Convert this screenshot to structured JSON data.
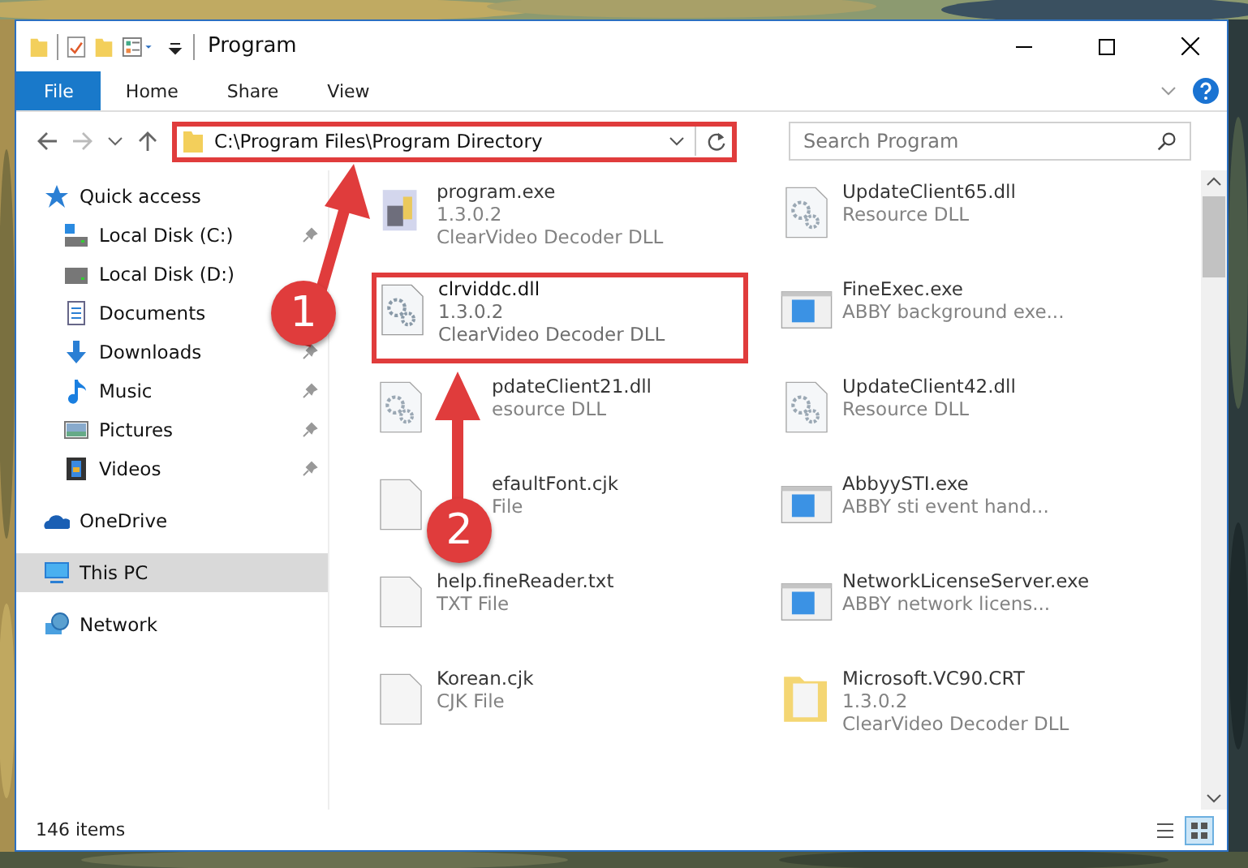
{
  "window": {
    "title": "Program"
  },
  "ribbon_tabs": [
    {
      "label": "File",
      "selected": true
    },
    {
      "label": "Home",
      "selected": false
    },
    {
      "label": "Share",
      "selected": false
    },
    {
      "label": "View",
      "selected": false
    }
  ],
  "address": {
    "path": "C:\\Program Files\\Program Directory",
    "highlighted": true
  },
  "search": {
    "placeholder": "Search Program"
  },
  "sidebar": {
    "items": [
      {
        "label": "Quick access",
        "kind": "star",
        "indent": false,
        "pinned": false,
        "selected": false
      },
      {
        "label": "Local Disk (C:)",
        "kind": "windrive",
        "indent": true,
        "pinned": true,
        "selected": false
      },
      {
        "label": "Local Disk (D:)",
        "kind": "drive",
        "indent": true,
        "pinned": false,
        "selected": false
      },
      {
        "label": "Documents",
        "kind": "documents",
        "indent": true,
        "pinned": false,
        "selected": false
      },
      {
        "label": "Downloads",
        "kind": "downloads",
        "indent": true,
        "pinned": true,
        "selected": false
      },
      {
        "label": "Music",
        "kind": "music",
        "indent": true,
        "pinned": true,
        "selected": false
      },
      {
        "label": "Pictures",
        "kind": "pictures",
        "indent": true,
        "pinned": true,
        "selected": false
      },
      {
        "label": "Videos",
        "kind": "videos",
        "indent": true,
        "pinned": true,
        "selected": false
      },
      {
        "label": "OneDrive",
        "kind": "cloud",
        "indent": false,
        "pinned": false,
        "selected": false
      },
      {
        "label": "This PC",
        "kind": "pc",
        "indent": false,
        "pinned": false,
        "selected": true
      },
      {
        "label": "Network",
        "kind": "network",
        "indent": false,
        "pinned": false,
        "selected": false
      }
    ]
  },
  "files": [
    {
      "name": "program.exe",
      "lines": [
        "1.3.0.2",
        "ClearVideo Decoder DLL"
      ],
      "kind": "app",
      "blurred": true,
      "highlighted": false,
      "covered": false
    },
    {
      "name": "UpdateClient65.dll",
      "lines": [
        "Resource DLL"
      ],
      "kind": "dll",
      "blurred": true,
      "highlighted": false,
      "covered": false
    },
    {
      "name": "clrviddc.dll",
      "lines": [
        "1.3.0.2",
        "ClearVideo Decoder DLL"
      ],
      "kind": "dll",
      "blurred": false,
      "highlighted": true,
      "covered": false
    },
    {
      "name": "FineExec.exe",
      "lines": [
        "ABBY background exe..."
      ],
      "kind": "exe",
      "blurred": true,
      "highlighted": false,
      "covered": false
    },
    {
      "name": "pdateClient21.dll",
      "lines": [
        "esource DLL"
      ],
      "kind": "dll",
      "blurred": true,
      "highlighted": false,
      "covered": true
    },
    {
      "name": "UpdateClient42.dll",
      "lines": [
        "Resource DLL"
      ],
      "kind": "dll",
      "blurred": true,
      "highlighted": false,
      "covered": false
    },
    {
      "name": "efaultFont.cjk",
      "lines": [
        "File"
      ],
      "kind": "text",
      "blurred": true,
      "highlighted": false,
      "covered": true
    },
    {
      "name": "AbbyySTI.exe",
      "lines": [
        "ABBY sti event hand..."
      ],
      "kind": "exe",
      "blurred": true,
      "highlighted": false,
      "covered": false
    },
    {
      "name": "help.fineReader.txt",
      "lines": [
        "TXT File"
      ],
      "kind": "text",
      "blurred": true,
      "highlighted": false,
      "covered": false
    },
    {
      "name": "NetworkLicenseServer.exe",
      "lines": [
        "ABBY network licens..."
      ],
      "kind": "exe",
      "blurred": true,
      "highlighted": false,
      "covered": false
    },
    {
      "name": "Korean.cjk",
      "lines": [
        "CJK File"
      ],
      "kind": "text",
      "blurred": true,
      "highlighted": false,
      "covered": false
    },
    {
      "name": "Microsoft.VC90.CRT",
      "lines": [
        "1.3.0.2",
        "ClearVideo Decoder DLL"
      ],
      "kind": "folder",
      "blurred": true,
      "highlighted": false,
      "covered": false
    }
  ],
  "status_bar": {
    "count": "146 items"
  },
  "steps": [
    {
      "number": "1",
      "kind": "up-right"
    },
    {
      "number": "2",
      "kind": "up"
    }
  ]
}
